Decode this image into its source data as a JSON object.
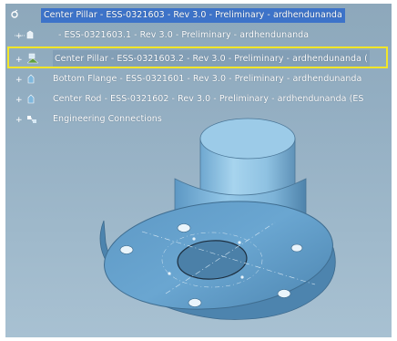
{
  "tree": {
    "root": {
      "label": "Center Pillar - ESS-0321603 - Rev 3.0 - Preliminary - ardhendunanda"
    },
    "children": [
      {
        "label": "- ESS-0321603.1 - Rev 3.0 - Preliminary - ardhendunanda"
      },
      {
        "label": "Center Pillar - ESS-0321603.2 - Rev 3.0 - Preliminary - ardhendunanda ("
      },
      {
        "label": "Bottom Flange - ESS-0321601 - Rev 3.0 - Preliminary - ardhendunanda"
      },
      {
        "label": "Center Rod - ESS-0321602 - Rev 3.0 - Preliminary - ardhendunanda (ES"
      },
      {
        "label": "Engineering Connections"
      }
    ]
  },
  "colors": {
    "background": "#9ab4c7",
    "selection_blue": "#3d73c9",
    "highlight_yellow": "#f2e628",
    "part_blue": "#7fb7dc"
  },
  "icons": [
    "product-icon",
    "part-icon",
    "assembly-icon",
    "part-icon",
    "part-icon",
    "connections-icon"
  ]
}
